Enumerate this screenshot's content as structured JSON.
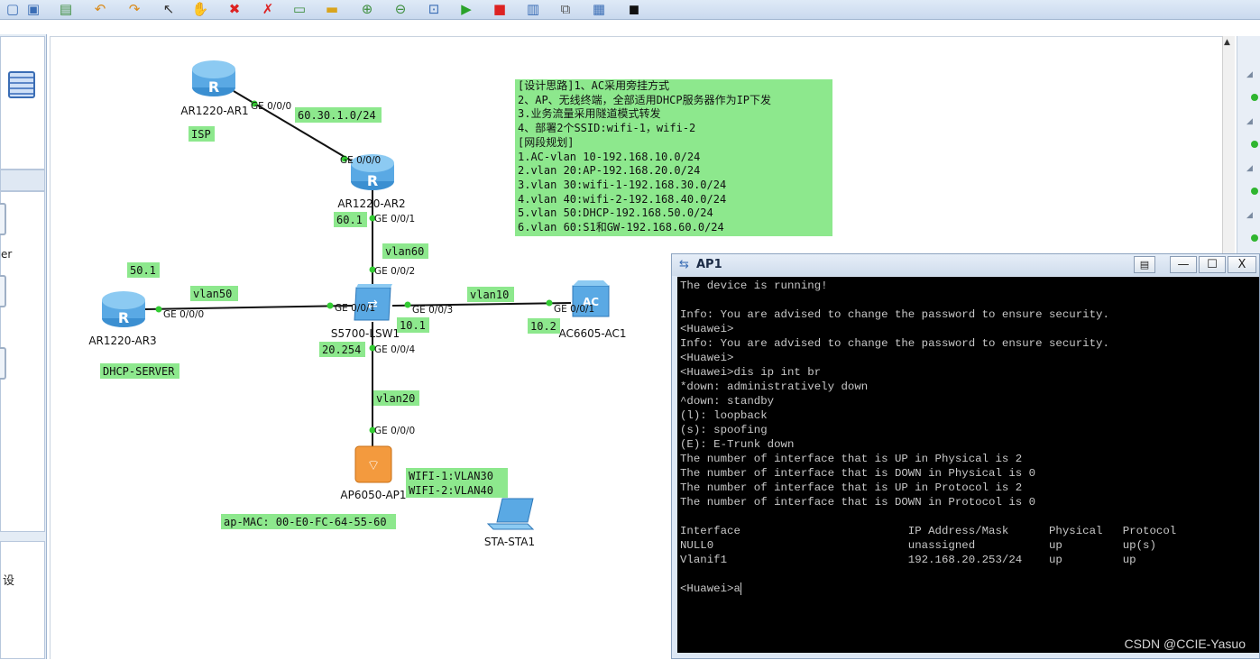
{
  "toolbar": {
    "icons": [
      "new-file-icon",
      "save-icon",
      "save-as-icon",
      "undo-icon",
      "redo-icon",
      "select-icon",
      "hand-icon",
      "delete-icon",
      "delete-all-icon",
      "text-icon",
      "rect-icon",
      "zoom-in-icon",
      "zoom-out-icon",
      "fit-icon",
      "start-icon",
      "stop-icon",
      "capture-icon",
      "topology-icon",
      "grid-icon",
      "cli-icon"
    ]
  },
  "left_panel": {
    "partial_label_1": "er",
    "partial_label_2": "设"
  },
  "devices": [
    {
      "id": "ar1",
      "name": "AR1220-AR1",
      "type": "router"
    },
    {
      "id": "ar2",
      "name": "AR1220-AR2",
      "type": "router"
    },
    {
      "id": "ar3",
      "name": "AR1220-AR3",
      "type": "router"
    },
    {
      "id": "lsw1",
      "name": "S5700-LSW1",
      "type": "switch"
    },
    {
      "id": "ac1",
      "name": "AC6605-AC1",
      "type": "ac"
    },
    {
      "id": "ap1",
      "name": "AP6050-AP1",
      "type": "ap"
    },
    {
      "id": "sta1",
      "name": "STA-STA1",
      "type": "station"
    }
  ],
  "ports": {
    "ar1_g000": "GE 0/0/0",
    "ar2_g000": "GE 0/0/0",
    "ar2_g001": "GE 0/0/1",
    "lsw_g002": "GE 0/0/2",
    "lsw_g001": "GE 0/0/1",
    "lsw_g003": "GE 0/0/3",
    "lsw_g004": "GE 0/0/4",
    "ar3_g000": "GE 0/0/0",
    "ac_g001": "GE 0/0/1",
    "ap_g000": "GE 0/0/0"
  },
  "labels": {
    "isp": "ISP",
    "net_isp": "60.30.1.0/24",
    "ip_60_1": "60.1",
    "vlan60": "vlan60",
    "ip_50_1": "50.1",
    "vlan50": "vlan50",
    "vlan10": "vlan10",
    "ip_10_1": "10.1",
    "ip_10_2": "10.2",
    "ip_20_254": "20.254",
    "dhcp_server": "DHCP-SERVER",
    "vlan20": "vlan20",
    "wifi1": "WIFI-1:VLAN30",
    "wifi2": "WIFI-2:VLAN40",
    "ap_mac": "ap-MAC: 00-E0-FC-64-55-60"
  },
  "notes": [
    "[设计思路]1、AC采用旁挂方式",
    "2、AP、无线终端，全部适用DHCP服务器作为IP下发",
    "3.业务流量采用隧道模式转发",
    "4、部署2个SSID:wifi-1，wifi-2",
    "[网段规划]",
    "1.AC-vlan 10-192.168.10.0/24",
    "2.vlan 20:AP-192.168.20.0/24",
    "3.vlan 30:wifi-1-192.168.30.0/24",
    "4.vlan 40:wifi-2-192.168.40.0/24",
    "5.vlan 50:DHCP-192.168.50.0/24",
    "6.vlan 60:S1和GW-192.168.60.0/24"
  ],
  "terminal": {
    "title": "AP1",
    "buttons": {
      "minimize": "—",
      "maximize": "☐",
      "close": "X"
    },
    "lines": [
      "The device is running!",
      "",
      "Info: You are advised to change the password to ensure security.",
      "<Huawei>",
      "Info: You are advised to change the password to ensure security.",
      "<Huawei>",
      "<Huawei>dis ip int br",
      "*down: administratively down",
      "^down: standby",
      "(l): loopback",
      "(s): spoofing",
      "(E): E-Trunk down",
      "The number of interface that is UP in Physical is 2",
      "The number of interface that is DOWN in Physical is 0",
      "The number of interface that is UP in Protocol is 2",
      "The number of interface that is DOWN in Protocol is 0",
      "",
      "Interface                         IP Address/Mask      Physical   Protocol",
      "NULL0                             unassigned           up         up(s)",
      "Vlanif1                           192.168.20.253/24    up         up",
      "",
      "<Huawei>a"
    ]
  },
  "watermark": "CSDN @CCIE-Yasuo",
  "colors": {
    "label_bg": "#8de88d",
    "port_dot": "#33cc33",
    "terminal_bg": "#000000",
    "terminal_fg": "#c8c8c8"
  }
}
